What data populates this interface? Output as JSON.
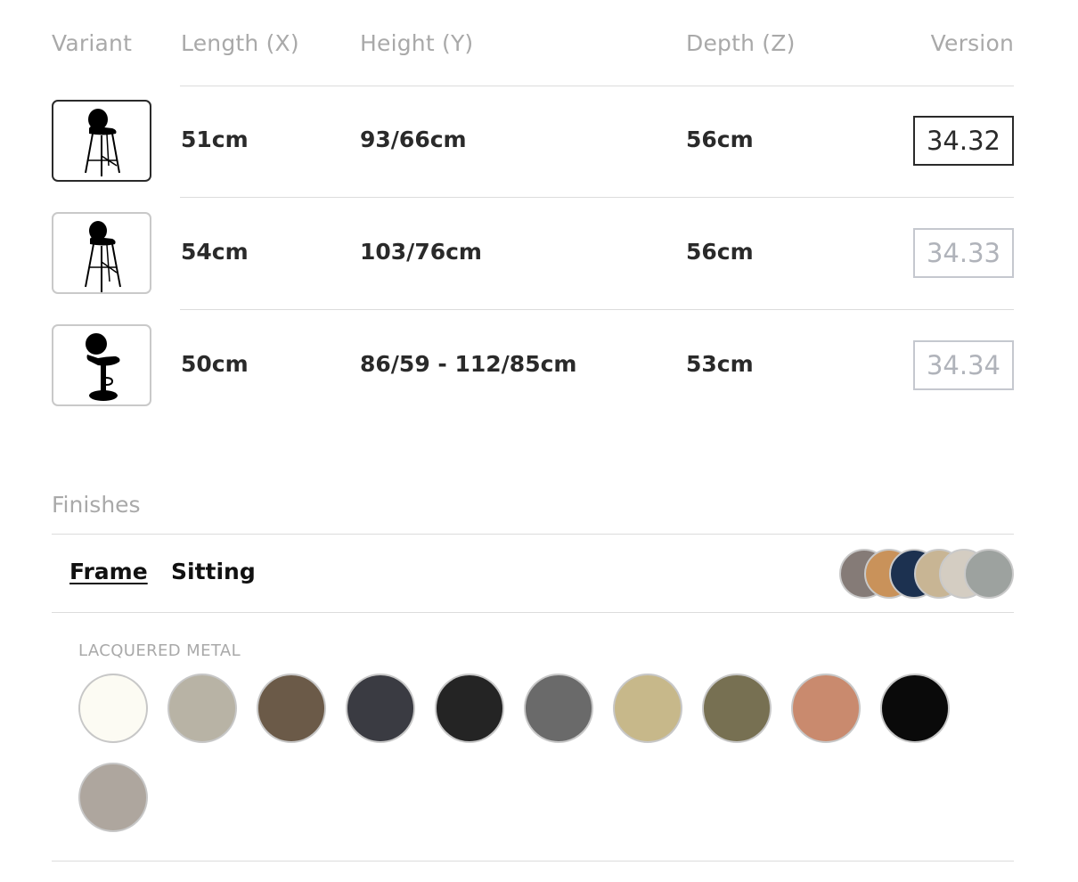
{
  "table": {
    "headers": {
      "variant": "Variant",
      "length": "Length (X)",
      "height": "Height (Y)",
      "depth": "Depth (Z)",
      "version": "Version"
    },
    "rows": [
      {
        "icon": "counter-stool-icon",
        "length": "51cm",
        "height": "93/66cm",
        "depth": "56cm",
        "version": "34.32",
        "selected": true
      },
      {
        "icon": "bar-stool-icon",
        "length": "54cm",
        "height": "103/76cm",
        "depth": "56cm",
        "version": "34.33",
        "selected": false
      },
      {
        "icon": "swivel-stool-icon",
        "length": "50cm",
        "height": "86/59 - 112/85cm",
        "depth": "53cm",
        "version": "34.34",
        "selected": false
      }
    ]
  },
  "finishes": {
    "title": "Finishes",
    "tabs": [
      {
        "label": "Frame",
        "active": true
      },
      {
        "label": "Sitting",
        "active": false
      }
    ],
    "preview_colors": [
      "#857b77",
      "#c9925a",
      "#1c3150",
      "#c8b594",
      "#d4cdc2",
      "#9da29f"
    ],
    "group_label": "LACQUERED METAL",
    "swatches": [
      {
        "color": "#fcfbf3"
      },
      {
        "color": "#b8b3a5"
      },
      {
        "color": "#6b5a48"
      },
      {
        "color": "#3a3b42"
      },
      {
        "color": "#242424"
      },
      {
        "color": "#6a6a6a"
      },
      {
        "color": "#c7b88a"
      },
      {
        "color": "#777052"
      },
      {
        "color": "#c98a6e"
      },
      {
        "color": "#0a0a0a"
      },
      {
        "color": "#aea69e"
      }
    ]
  }
}
